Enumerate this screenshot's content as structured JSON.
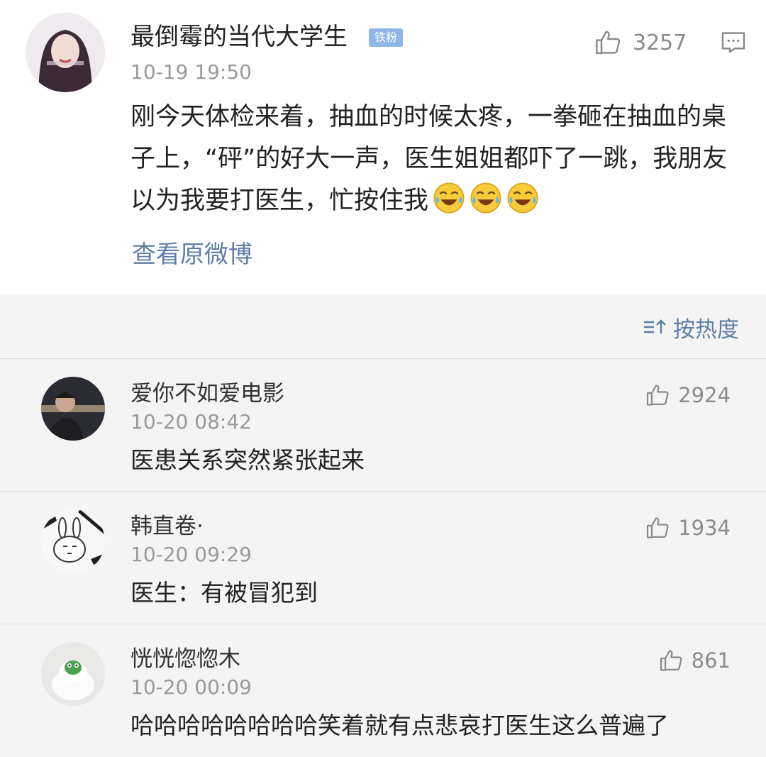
{
  "post": {
    "author": "最倒霉的当代大学生",
    "badge": "铁粉",
    "time": "10-19 19:50",
    "likes": "3257",
    "text": "刚今天体检来着，抽血的时候太疼，一拳砸在抽血的桌子上，“砰”的好大一声，医生姐姐都吓了一跳，我朋友以为我要打医生，忙按住我",
    "emojis": [
      "laugh-cry-emoji",
      "laugh-cry-emoji",
      "laugh-cry-emoji"
    ],
    "view_original": "查看原微博"
  },
  "sort": {
    "label": "按热度",
    "icon": "sort-icon"
  },
  "comments": [
    {
      "name": "爱你不如爱电影",
      "time": "10-20 08:42",
      "likes": "2924",
      "text": "医患关系突然紧张起来"
    },
    {
      "name": "韩直卷·",
      "time": "10-20 09:29",
      "likes": "1934",
      "text": "医生：有被冒犯到"
    },
    {
      "name": "恍恍惚惚木",
      "time": "10-20 00:09",
      "likes": "861",
      "text": "哈哈哈哈哈哈哈哈笑着就有点悲哀打医生这么普遍了"
    }
  ],
  "colors": {
    "link": "#5e7ea8",
    "muted": "#9a9a9a",
    "badge": "#8fb6e6",
    "background": "#f4f4f4"
  }
}
